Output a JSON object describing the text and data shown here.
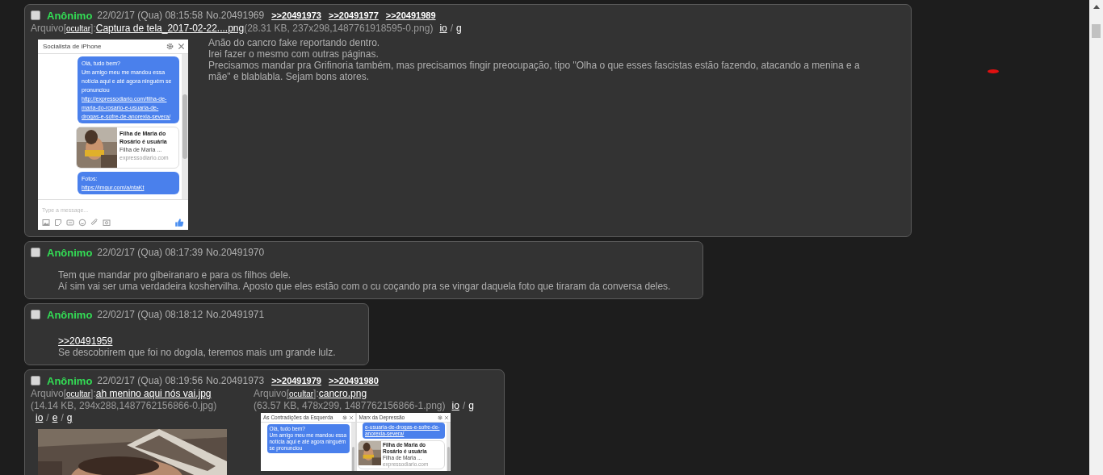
{
  "posts": [
    {
      "checked": false,
      "name": "Anônimo",
      "date": "22/02/17 (Qua) 08:15:58",
      "number": "No.20491969",
      "backlinks": [
        ">>20491973",
        ">>20491977",
        ">>20491989"
      ],
      "files": [
        {
          "label": "Arquivo",
          "open": "[",
          "hide": "ocultar",
          "close": "]:",
          "filename": "Captura de tela_2017-02-22....png",
          "info": "(28.31 KB, 237x298,1487761918595-0.png)",
          "links": [
            "io",
            "g"
          ],
          "separator": "/",
          "thumb": {
            "kind": "chat",
            "panels": [
              {
                "title": "Socialista de iPhone",
                "messages": [
                  {
                    "kind": "bubble",
                    "text": "Olá, tudo bem?\nUm amigo meu me mandou essa notícia aqui e até agora ninguém se pronunciou",
                    "link": "http://expressodiario.com/filha-de-maria-do-rosario-e-usuaria-de-drogas-e-sofre-de-anorexia-severa/"
                  },
                  {
                    "kind": "card",
                    "title": "Filha de Maria do Rosário é usuária",
                    "snippet": "Filha de Maria ...",
                    "site": "expressodiario.com"
                  },
                  {
                    "kind": "bubble",
                    "text": "Fotos:",
                    "link": "https://imgur.com/a/ntaKt"
                  }
                ],
                "placeholder": "Type a message..."
              }
            ]
          }
        }
      ],
      "body": [
        {
          "kind": "text",
          "text": "Anão do cancro fake reportando dentro."
        },
        {
          "kind": "text",
          "text": "Irei fazer o mesmo com outras páginas."
        },
        {
          "kind": "text",
          "text": "Precisamos mandar pra Grifinoria também, mas precisamos fingir preocupação, tipo \"Olha o que esses fascistas estão fazendo, atacando a menina e a mãe\" e blablabla. Sejam bons atores."
        }
      ]
    },
    {
      "checked": false,
      "name": "Anônimo",
      "date": "22/02/17 (Qua) 08:17:39",
      "number": "No.20491970",
      "body": [
        {
          "kind": "text",
          "text": "Tem que mandar pro gibeiranaro e para os filhos dele."
        },
        {
          "kind": "text",
          "text": "Aí sim vai ser uma verdadeira koshervilha. Aposto que eles estão com o cu coçando pra se vingar daquela foto que tiraram da conversa deles."
        }
      ]
    },
    {
      "checked": false,
      "name": "Anônimo",
      "date": "22/02/17 (Qua) 08:18:12",
      "number": "No.20491971",
      "body": [
        {
          "kind": "quote",
          "text": ">>20491959"
        },
        {
          "kind": "text",
          "text": "Se descobrirem que foi no dogola, teremos mais um grande lulz."
        }
      ]
    },
    {
      "checked": false,
      "name": "Anônimo",
      "date": "22/02/17 (Qua) 08:19:56",
      "number": "No.20491973",
      "backlinks": [
        ">>20491979",
        ">>20491980"
      ],
      "files": [
        {
          "label": "Arquivo",
          "open": "[",
          "hide": "ocultar",
          "close": "]:",
          "filename": "ah menino aqui nós vai.jpg",
          "info": "(14.14 KB, 294x288,1487762156866-0.jpg)",
          "links": [
            "io",
            "e",
            "g"
          ],
          "separator": "/",
          "thumb": {
            "kind": "picture"
          }
        },
        {
          "label": "Arquivo",
          "open": "[",
          "hide": "ocultar",
          "close": "]:",
          "filename": "cancro.png",
          "info": "(63.57 KB, 478x299, 1487762156866-1.png)",
          "links": [
            "io",
            "g"
          ],
          "separator": "/",
          "thumb": {
            "kind": "chat",
            "panels": [
              {
                "title": "As Contradições da Esquerda",
                "messages": [
                  {
                    "kind": "bubble",
                    "text": "Olá, tudo bem?\nUm amigo meu me mandou essa notícia aqui e até agora ninguém se pronunciou"
                  }
                ]
              },
              {
                "title": "Marx da Depressão",
                "messages": [
                  {
                    "kind": "bubble",
                    "link": "e-usuaria-de-drogas-e-sofre-de-anorexia-severa/"
                  },
                  {
                    "kind": "card",
                    "title": "Filha de Maria do Rosário é usuária",
                    "snippet": "Filha de Maria ...",
                    "site": "expressodiario.com"
                  }
                ]
              }
            ]
          }
        }
      ]
    }
  ]
}
